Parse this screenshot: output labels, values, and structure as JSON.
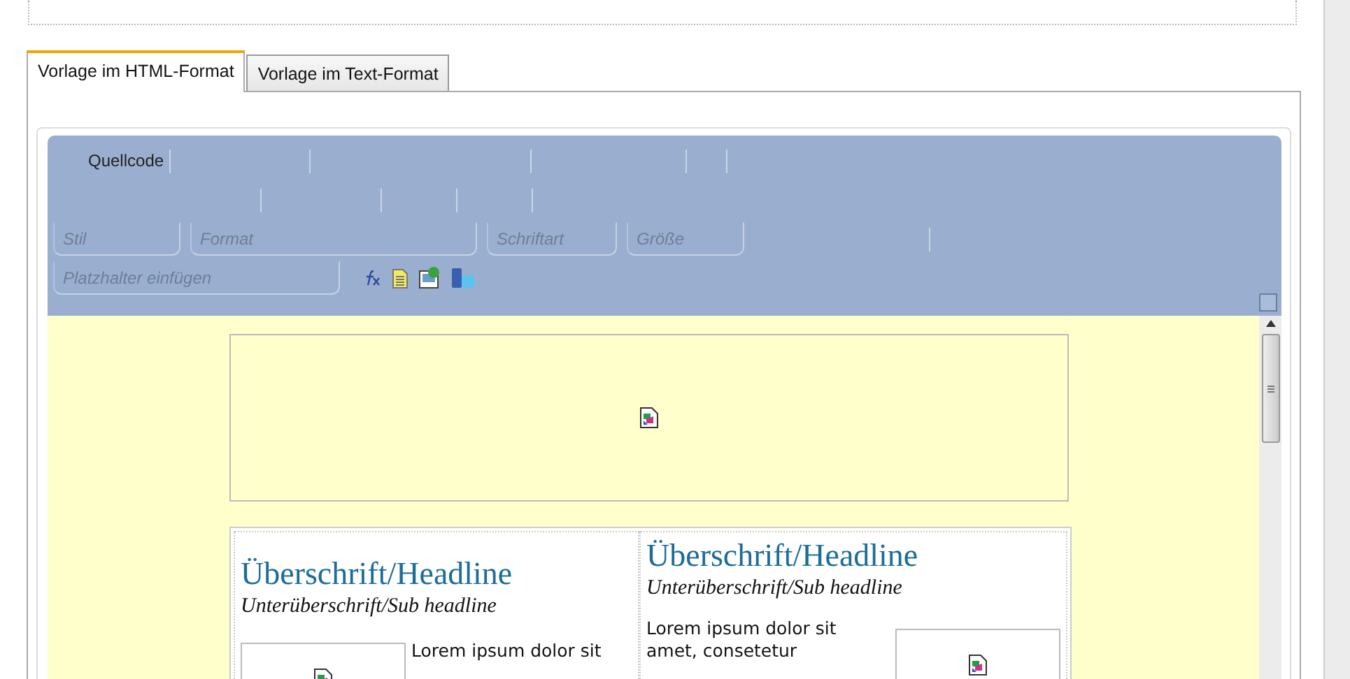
{
  "tabs": [
    {
      "label": "Vorlage im HTML-Format",
      "selected": true
    },
    {
      "label": "Vorlage im Text-Format",
      "selected": false
    }
  ],
  "editor": {
    "toolbar": {
      "source_button": "Quellcode",
      "dropdowns": [
        {
          "label": "Stil"
        },
        {
          "label": "Format"
        },
        {
          "label": "Schriftart"
        },
        {
          "label": "Größe"
        }
      ],
      "placeholder_dropdown": "Platzhalter einfügen"
    },
    "content": {
      "columns": [
        {
          "headline": "Überschrift/Headline",
          "subheadline": "Unterüberschrift/Sub headline",
          "body": "Lorem ipsum dolor sit",
          "kind": "left"
        },
        {
          "headline": "Überschrift/Headline",
          "subheadline": "Unterüberschrift/Sub headline",
          "body": "Lorem ipsum dolor sit amet, consetetur",
          "kind": "right"
        }
      ]
    }
  }
}
